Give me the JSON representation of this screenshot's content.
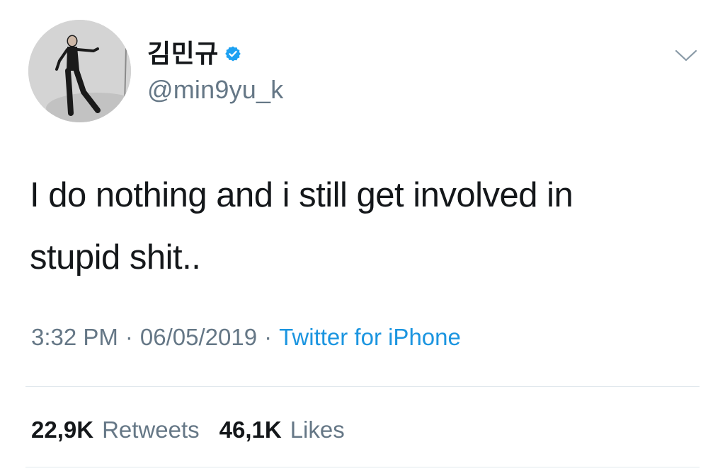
{
  "tweet": {
    "author": {
      "display_name": "김민규",
      "handle": "@min9yu_k",
      "verified": true,
      "avatar": "profile-photo"
    },
    "text": "I do nothing and i still get involved in\nstupid shit..",
    "meta": {
      "time": "3:32 PM",
      "date": "06/05/2019",
      "separator": "·",
      "source": "Twitter for iPhone"
    },
    "stats": {
      "retweets_count": "22,9K",
      "retweets_label": "Retweets",
      "likes_count": "46,1K",
      "likes_label": "Likes"
    }
  },
  "icons": {
    "verified": "verified-badge-icon",
    "menu": "chevron-down-icon"
  },
  "colors": {
    "text_primary": "#14171a",
    "text_secondary": "#657786",
    "link": "#1b95e0",
    "verified": "#1da1f2",
    "divider": "#e1e8ed"
  }
}
